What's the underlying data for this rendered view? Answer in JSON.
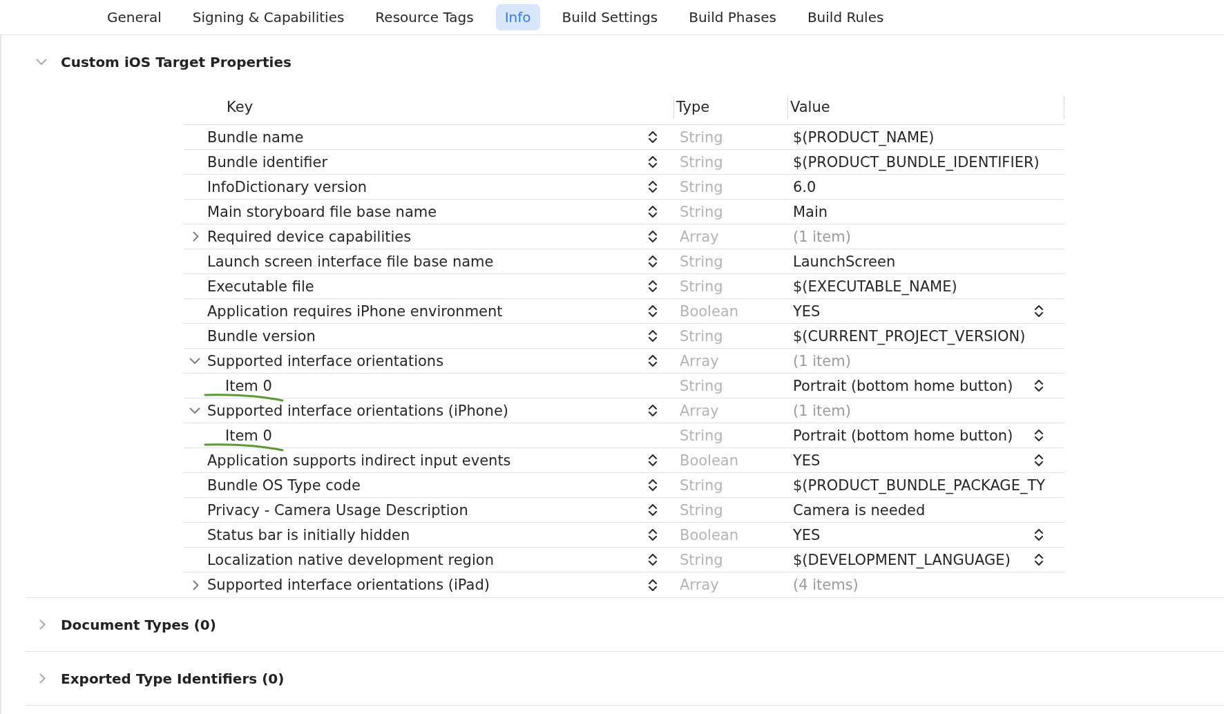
{
  "tabs": [
    {
      "label": "General",
      "selected": false
    },
    {
      "label": "Signing & Capabilities",
      "selected": false
    },
    {
      "label": "Resource Tags",
      "selected": false
    },
    {
      "label": "Info",
      "selected": true
    },
    {
      "label": "Build Settings",
      "selected": false
    },
    {
      "label": "Build Phases",
      "selected": false
    },
    {
      "label": "Build Rules",
      "selected": false
    }
  ],
  "sections": [
    {
      "title": "Custom iOS Target Properties",
      "expanded": true,
      "table": {
        "columns": [
          "Key",
          "Type",
          "Value"
        ],
        "rows": [
          {
            "kind": "text",
            "key": "Bundle name",
            "type": "String",
            "value": "$(PRODUCT_NAME)"
          },
          {
            "kind": "text",
            "key": "Bundle identifier",
            "type": "String",
            "value": "$(PRODUCT_BUNDLE_IDENTIFIER)"
          },
          {
            "kind": "text",
            "key": "InfoDictionary version",
            "type": "String",
            "value": "6.0"
          },
          {
            "kind": "text",
            "key": "Main storyboard file base name",
            "type": "String",
            "value": "Main"
          },
          {
            "kind": "array",
            "key": "Required device capabilities",
            "type": "Array",
            "value": "(1 item)",
            "expanded": false
          },
          {
            "kind": "text",
            "key": "Launch screen interface file base name",
            "type": "String",
            "value": "LaunchScreen"
          },
          {
            "kind": "text",
            "key": "Executable file",
            "type": "String",
            "value": "$(EXECUTABLE_NAME)"
          },
          {
            "kind": "popup",
            "key": "Application requires iPhone environment",
            "type": "Boolean",
            "value": "YES"
          },
          {
            "kind": "text",
            "key": "Bundle version",
            "type": "String",
            "value": "$(CURRENT_PROJECT_VERSION)"
          },
          {
            "kind": "array",
            "key": "Supported interface orientations",
            "type": "Array",
            "value": "(1 item)",
            "expanded": true,
            "children": [
              {
                "kind": "popup",
                "key": "Item 0",
                "type": "String",
                "value": "Portrait (bottom home button)",
                "underlined": true
              }
            ]
          },
          {
            "kind": "array",
            "key": "Supported interface orientations (iPhone)",
            "type": "Array",
            "value": "(1 item)",
            "expanded": true,
            "children": [
              {
                "kind": "popup",
                "key": "Item 0",
                "type": "String",
                "value": "Portrait (bottom home button)",
                "underlined": true
              }
            ]
          },
          {
            "kind": "popup",
            "key": "Application supports indirect input events",
            "type": "Boolean",
            "value": "YES"
          },
          {
            "kind": "text",
            "key": "Bundle OS Type code",
            "type": "String",
            "value": "$(PRODUCT_BUNDLE_PACKAGE_TY"
          },
          {
            "kind": "text",
            "key": "Privacy - Camera Usage Description",
            "type": "String",
            "value": "Camera is needed"
          },
          {
            "kind": "popup",
            "key": "Status bar is initially hidden",
            "type": "Boolean",
            "value": "YES"
          },
          {
            "kind": "popup",
            "key": "Localization native development region",
            "type": "String",
            "value": "$(DEVELOPMENT_LANGUAGE)"
          },
          {
            "kind": "array",
            "key": "Supported interface orientations (iPad)",
            "type": "Array",
            "value": "(4 items)",
            "expanded": false
          }
        ]
      }
    },
    {
      "title": "Document Types (0)",
      "expanded": false
    },
    {
      "title": "Exported Type Identifiers (0)",
      "expanded": false
    }
  ]
}
